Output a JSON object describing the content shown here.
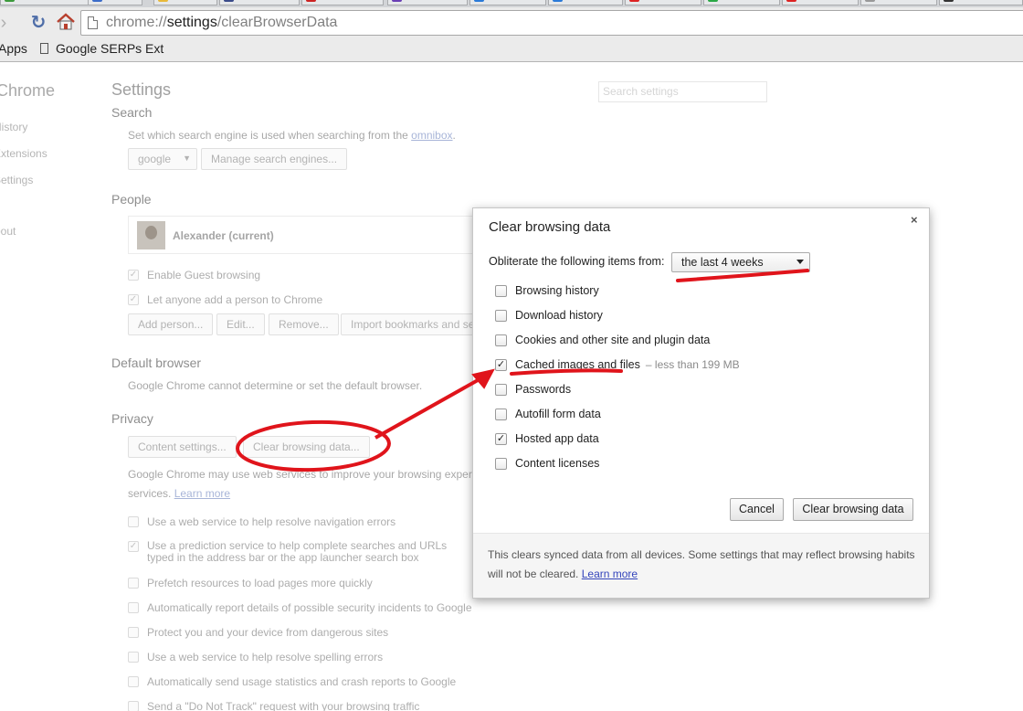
{
  "browser": {
    "url_scheme": "chrome://",
    "url_host": "settings",
    "url_path": "/clearBrowserData",
    "bookmarks": {
      "apps_label": "Apps",
      "item_1": "Google SERPs Ext"
    }
  },
  "settings": {
    "nav": {
      "brand": "Chrome",
      "items": [
        "History",
        "Extensions",
        "Settings",
        "About"
      ]
    },
    "page_title": "Settings",
    "search_placeholder": "Search settings",
    "search": {
      "title": "Search",
      "desc_prefix": "Set which search engine is used when searching from the ",
      "omnibox_link": "omnibox",
      "desc_suffix": ".",
      "engine_value": "google",
      "manage_button": "Manage search engines..."
    },
    "people": {
      "title": "People",
      "user_name": "Alexander (current)",
      "guest_label": "Enable Guest browsing",
      "add_person_label": "Let anyone add a person to Chrome",
      "buttons": {
        "add": "Add person...",
        "edit": "Edit...",
        "remove": "Remove...",
        "import": "Import bookmarks and settings..."
      }
    },
    "default_browser": {
      "title": "Default browser",
      "desc": "Google Chrome cannot determine or set the default browser."
    },
    "privacy": {
      "title": "Privacy",
      "content_settings": "Content settings...",
      "clear_data": "Clear browsing data...",
      "desc_line1": "Google Chrome may use web services to improve your browsing experience. You may optionally disable these",
      "desc_line2_prefix": "services. ",
      "learn_more": "Learn more",
      "options": [
        {
          "label": "Use a web service to help resolve navigation errors",
          "checked": false
        },
        {
          "label": "Use a prediction service to help complete searches and URLs typed in the address bar or the app launcher search box",
          "checked": true
        },
        {
          "label": "Prefetch resources to load pages more quickly",
          "checked": false
        },
        {
          "label": "Automatically report details of possible security incidents to Google",
          "checked": false
        },
        {
          "label": "Protect you and your device from dangerous sites",
          "checked": false
        },
        {
          "label": "Use a web service to help resolve spelling errors",
          "checked": false
        },
        {
          "label": "Automatically send usage statistics and crash reports to Google",
          "checked": false
        },
        {
          "label": "Send a \"Do Not Track\" request with your browsing traffic",
          "checked": false
        }
      ]
    }
  },
  "dialog": {
    "title": "Clear browsing data",
    "close": "×",
    "obliterate_label": "Obliterate the following items from:",
    "period_value": "the last 4 weeks",
    "items": [
      {
        "label": "Browsing history",
        "checked": false,
        "note": ""
      },
      {
        "label": "Download history",
        "checked": false,
        "note": ""
      },
      {
        "label": "Cookies and other site and plugin data",
        "checked": false,
        "note": ""
      },
      {
        "label": "Cached images and files",
        "checked": true,
        "note": "–  less than 199 MB"
      },
      {
        "label": "Passwords",
        "checked": false,
        "note": ""
      },
      {
        "label": "Autofill form data",
        "checked": false,
        "note": ""
      },
      {
        "label": "Hosted app data",
        "checked": true,
        "note": ""
      },
      {
        "label": "Content licenses",
        "checked": false,
        "note": ""
      }
    ],
    "cancel": "Cancel",
    "clear": "Clear browsing data",
    "footer_text": "This clears synced data from all devices. Some settings that may reflect browsing habits will not be cleared.",
    "footer_link": "Learn more"
  },
  "colors": {
    "annotation": "#e0141b",
    "link": "#3344bb"
  }
}
